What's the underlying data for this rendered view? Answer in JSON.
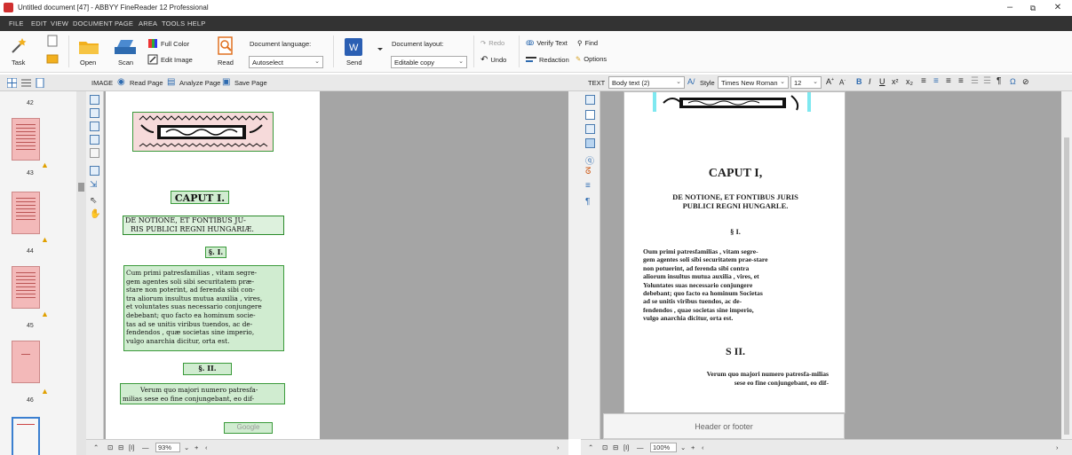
{
  "window": {
    "title": "Untitled document [47] - ABBYY FineReader 12 Professional",
    "min": "–",
    "max": "⧉",
    "close": "✕"
  },
  "menu": [
    "FILE",
    "EDIT",
    "VIEW",
    "DOCUMENT",
    "PAGE",
    "AREA",
    "TOOLS",
    "HELP"
  ],
  "ribbon": {
    "task": "Task",
    "open": "Open",
    "scan": "Scan",
    "read": "Read",
    "full_color": "Full Color",
    "edit_image": "Edit Image",
    "doc_language_label": "Document language:",
    "doc_language_value": "Autoselect",
    "send": "Send",
    "doc_layout_label": "Document layout:",
    "doc_layout_value": "Editable copy",
    "redo": "Redo",
    "undo": "Undo",
    "verify_text": "Verify Text",
    "find": "Find",
    "redaction": "Redaction",
    "options": "Options"
  },
  "image_toolbar": {
    "label": "IMAGE",
    "read_page": "Read Page",
    "analyze_page": "Analyze Page",
    "save_page": "Save Page"
  },
  "text_toolbar": {
    "label": "TEXT",
    "style_value": "Body text (2)",
    "style_label": "Style",
    "font": "Times New Roman",
    "size": "12",
    "special_char": "Ω"
  },
  "thumbnails": [
    "42",
    "43",
    "44",
    "45",
    "46"
  ],
  "image_page": {
    "caput": "CAPUT I.",
    "heading_line1": "DE NOTIONE, ET FONTIBUS JU-",
    "heading_line2": "RIS PUBLICI REGNI HUNGARIÆ.",
    "section1": "§. I.",
    "body": [
      "Cum primi patresfamilias , vitam segre-",
      "gem agentes soli sibi securitatem præ-",
      "stare non poterint, ad ferenda sibi con-",
      "tra aliorum insultus mutua auxilia , vires,",
      "et voluntates suas necessario conjungere",
      "debebant; quo facto ea hominum socie-",
      "tas ad se unitis viribus tuendos, ac de-",
      "fendendos , quæ societas sine imperio,",
      "vulgo anarchia dicitur, orta est."
    ],
    "section2": "§. II.",
    "body2": [
      "Verum quo majori numero patresfa-",
      "milias sese eo fine conjungebant, eo dif-"
    ],
    "footer_mark": "Google"
  },
  "text_page": {
    "caput": "CAPUT I,",
    "heading_line1": "DE NOTIONE, ET FONTIBUS JURIS",
    "heading_line2": "PUBLICI REGNI HUNGARLE.",
    "section1": "§ I.",
    "body": [
      "Oum primi patresfamilias , vitam segre-",
      "gem agentes soli sibi securitatem prae-stare",
      "non potuerint, ad ferenda sibi contra",
      "aliorum insultus mutua auxilia , vires, et",
      "Yoluntates suas necessario conjungere",
      "debebant; quo facto ea hominum Societas",
      "ad se unitis viribus tuendos, ac de-",
      "fendendos , quae societas sine imperio,",
      "vulgo anarchia dicitur, orta est."
    ],
    "section2": "S II.",
    "body2": [
      "Verum quo majori numero patresfa-milias",
      "sese eo fine conjungebant, eo dif-"
    ],
    "header_footer": "Header or footer"
  },
  "image_status": {
    "zoom": "93%"
  },
  "text_status": {
    "zoom": "100%"
  }
}
